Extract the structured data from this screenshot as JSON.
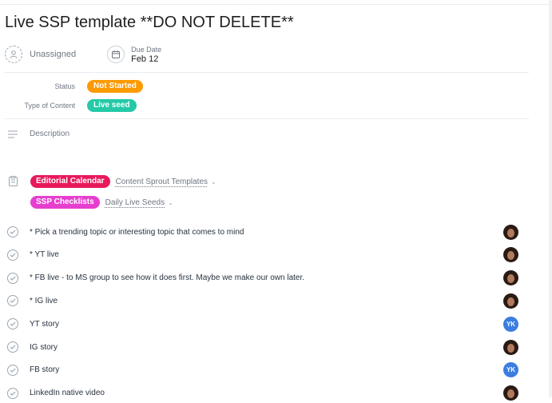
{
  "task": {
    "title": "Live SSP template **DO NOT DELETE**"
  },
  "assignee": {
    "label": "Unassigned",
    "icon": "person-icon"
  },
  "due": {
    "label": "Due Date",
    "value": "Feb 12",
    "icon": "calendar-icon"
  },
  "fields": [
    {
      "label": "Status",
      "value": "Not Started",
      "color": "#fd9a00"
    },
    {
      "label": "Type of Content",
      "value": "Live seed",
      "color": "#25c9a7"
    }
  ],
  "description": {
    "placeholder": "Description",
    "icon": "description-icon"
  },
  "projects": [
    {
      "name": "Editorial Calendar",
      "color": "#e8195a",
      "section": "Content Sprout Templates"
    },
    {
      "name": "SSP Checklists",
      "color": "#e63fd0",
      "section": "Daily Live Seeds"
    }
  ],
  "subtasks": [
    {
      "name": "* Pick a trending topic or interesting topic that comes to mind",
      "assignee": "photo"
    },
    {
      "name": "* YT live",
      "assignee": "photo"
    },
    {
      "name": "* FB live - to MS group to see how it does first. Maybe we make our own later.",
      "assignee": "photo"
    },
    {
      "name": "* IG live",
      "assignee": "photo"
    },
    {
      "name": "YT story",
      "assignee": "YK"
    },
    {
      "name": "IG story",
      "assignee": "photo"
    },
    {
      "name": "FB story",
      "assignee": "YK"
    },
    {
      "name": "LinkedIn native video",
      "assignee": "photo"
    }
  ]
}
